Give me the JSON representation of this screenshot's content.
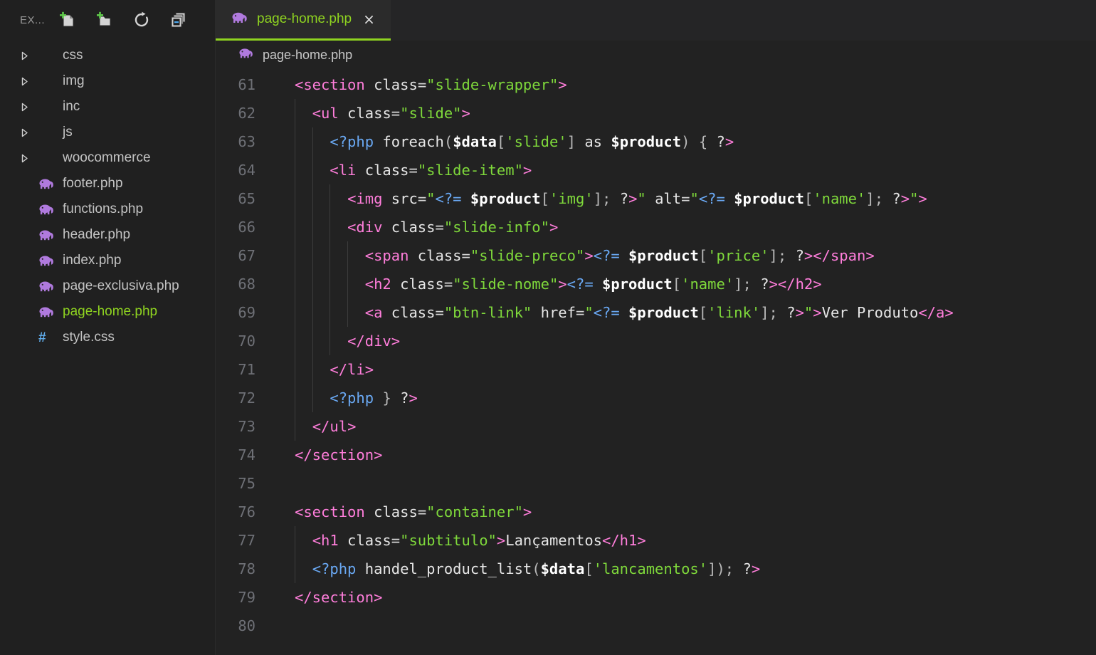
{
  "sidebar": {
    "title": "EX...",
    "actions": [
      {
        "name": "new-file-icon",
        "label": "New File"
      },
      {
        "name": "new-folder-icon",
        "label": "New Folder"
      },
      {
        "name": "refresh-icon",
        "label": "Refresh Explorer"
      },
      {
        "name": "collapse-all-icon",
        "label": "Collapse Folders in Explorer"
      }
    ],
    "tree": [
      {
        "label": "css",
        "type": "folder",
        "expanded": false,
        "active": false
      },
      {
        "label": "img",
        "type": "folder",
        "expanded": false,
        "active": false
      },
      {
        "label": "inc",
        "type": "folder",
        "expanded": false,
        "active": false
      },
      {
        "label": "js",
        "type": "folder",
        "expanded": false,
        "active": false
      },
      {
        "label": "woocommerce",
        "type": "folder",
        "expanded": false,
        "active": false
      },
      {
        "label": "footer.php",
        "type": "php",
        "active": false
      },
      {
        "label": "functions.php",
        "type": "php",
        "active": false
      },
      {
        "label": "header.php",
        "type": "php",
        "active": false
      },
      {
        "label": "index.php",
        "type": "php",
        "active": false
      },
      {
        "label": "page-exclusiva.php",
        "type": "php",
        "active": false
      },
      {
        "label": "page-home.php",
        "type": "php",
        "active": true
      },
      {
        "label": "style.css",
        "type": "css",
        "active": false
      }
    ]
  },
  "editor": {
    "tab": {
      "label": "page-home.php",
      "close": "×",
      "icon": "php-elephant-icon"
    },
    "breadcrumb": {
      "label": "page-home.php",
      "icon": "php-elephant-icon"
    },
    "first_line_number": 61,
    "last_line_number": 80,
    "lines": [
      {
        "n": 61,
        "text": "<section class=\"slide-wrapper\">"
      },
      {
        "n": 62,
        "text": "  <ul class=\"slide\">"
      },
      {
        "n": 63,
        "text": "    <?php foreach($data['slide'] as $product) { ?>"
      },
      {
        "n": 64,
        "text": "    <li class=\"slide-item\">"
      },
      {
        "n": 65,
        "text": "      <img src=\"<?= $product['img']; ?>\" alt=\"<?= $product['name']; ?>\">"
      },
      {
        "n": 66,
        "text": "      <div class=\"slide-info\">"
      },
      {
        "n": 67,
        "text": "        <span class=\"slide-preco\"><?= $product['price']; ?></span>"
      },
      {
        "n": 68,
        "text": "        <h2 class=\"slide-nome\"><?= $product['name']; ?></h2>"
      },
      {
        "n": 69,
        "text": "        <a class=\"btn-link\" href=\"<?= $product['link']; ?>\">Ver Produto</a>"
      },
      {
        "n": 70,
        "text": "      </div>"
      },
      {
        "n": 71,
        "text": "    </li>"
      },
      {
        "n": 72,
        "text": "    <?php } ?>"
      },
      {
        "n": 73,
        "text": "  </ul>"
      },
      {
        "n": 74,
        "text": "</section>"
      },
      {
        "n": 75,
        "text": ""
      },
      {
        "n": 76,
        "text": "<section class=\"container\">"
      },
      {
        "n": 77,
        "text": "  <h1 class=\"subtitulo\">Lançamentos</h1>"
      },
      {
        "n": 78,
        "text": "  <?php handel_product_list($data['lancamentos']); ?>"
      },
      {
        "n": 79,
        "text": "</section>"
      },
      {
        "n": 80,
        "text": ""
      }
    ]
  },
  "colors": {
    "accent": "#8fd420",
    "php_icon": "#b07ade",
    "css_icon": "#61afef",
    "sidebar_bg": "#202020",
    "editor_bg": "#222222",
    "tab_bg": "#2b2b2b",
    "tag": "#ff7edb",
    "attribute": "#ffe23f",
    "string": "#7fd93b",
    "php_delim": "#6aa9f4",
    "keyword": "#ff8c3a",
    "variable": "#ffffff",
    "linenumber": "#6e7076"
  }
}
